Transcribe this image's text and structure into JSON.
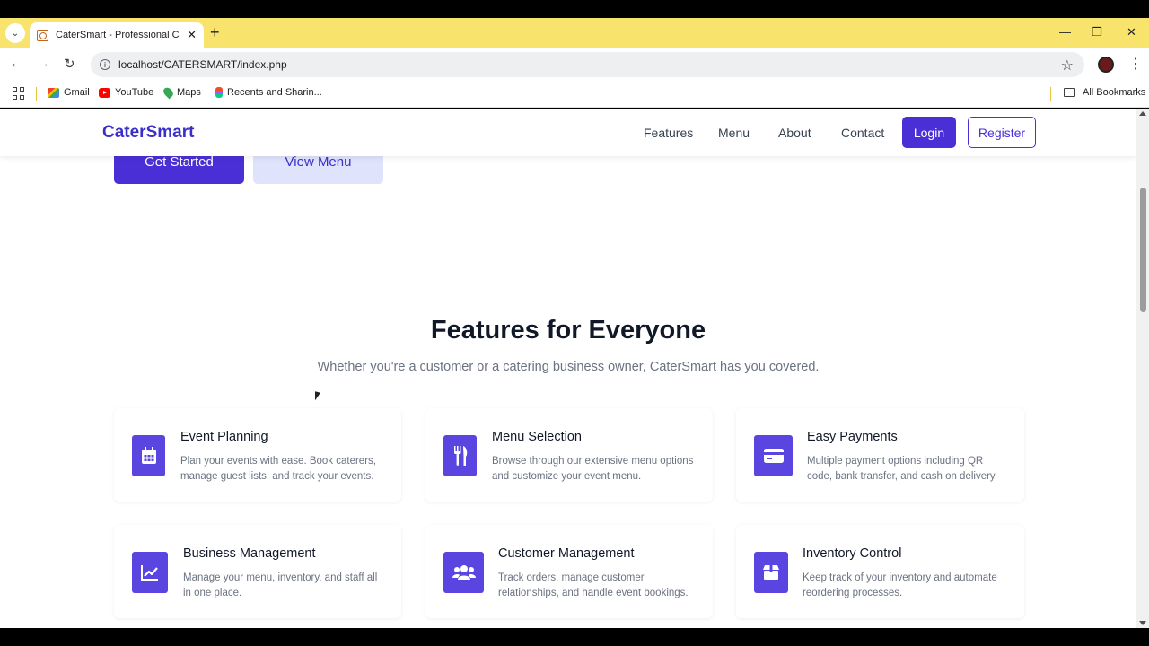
{
  "browser": {
    "tab_title": "CaterSmart - Professional Cater",
    "url": "localhost/CATERSMART/index.php",
    "bookmarks": [
      {
        "label": "Gmail",
        "icon": "gmail-icon"
      },
      {
        "label": "YouTube",
        "icon": "youtube-icon"
      },
      {
        "label": "Maps",
        "icon": "maps-icon"
      },
      {
        "label": "Recents and Sharin...",
        "icon": "figma-icon"
      }
    ],
    "all_bookmarks": "All Bookmarks"
  },
  "site": {
    "brand": "CaterSmart",
    "nav": [
      "Features",
      "Menu",
      "About",
      "Contact"
    ],
    "login": "Login",
    "register": "Register",
    "accent_color": "#4b2fd6"
  },
  "hero": {
    "get_started": "Get Started",
    "view_menu": "View Menu"
  },
  "features": {
    "title": "Features for Everyone",
    "subtitle": "Whether you're a customer or a catering business owner, CaterSmart has you covered.",
    "cards": [
      {
        "title": "Event Planning",
        "desc": "Plan your events with ease. Book caterers, manage guest lists, and track your events.",
        "icon": "calendar-icon"
      },
      {
        "title": "Menu Selection",
        "desc": "Browse through our extensive menu options and customize your event menu.",
        "icon": "utensils-icon"
      },
      {
        "title": "Easy Payments",
        "desc": "Multiple payment options including QR code, bank transfer, and cash on delivery.",
        "icon": "credit-card-icon"
      },
      {
        "title": "Business Management",
        "desc": "Manage your menu, inventory, and staff all in one place.",
        "icon": "chart-line-icon"
      },
      {
        "title": "Customer Management",
        "desc": "Track orders, manage customer relationships, and handle event bookings.",
        "icon": "users-icon"
      },
      {
        "title": "Inventory Control",
        "desc": "Keep track of your inventory and automate reordering processes.",
        "icon": "box-icon"
      }
    ]
  }
}
